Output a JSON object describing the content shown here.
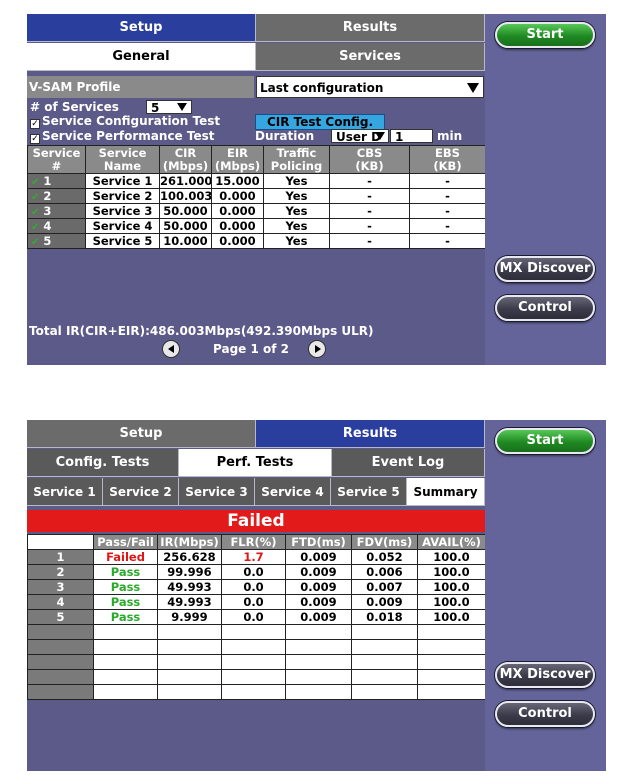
{
  "screen1": {
    "tabs": {
      "setup": "Setup",
      "results": "Results",
      "general": "General",
      "services": "Services"
    },
    "vsam_profile_label": "V-SAM Profile",
    "vsam_profile_value": "Last configuration",
    "num_services_label": "# of Services",
    "num_services_value": "5",
    "service_config_test": "Service Configuration Test",
    "service_perf_test": "Service Performance Test",
    "cir_test_config": "CIR Test Config.",
    "duration_label": "Duration",
    "duration_unit_value": "User D",
    "duration_value": "1",
    "duration_unit": "min",
    "table": {
      "headers": [
        [
          "Service",
          "#"
        ],
        [
          "Service",
          "Name"
        ],
        [
          "CIR",
          "(Mbps)"
        ],
        [
          "EIR",
          "(Mbps)"
        ],
        [
          "Traffic",
          "Policing"
        ],
        [
          "CBS",
          "(KB)"
        ],
        [
          "EBS",
          "(KB)"
        ]
      ],
      "rows": [
        {
          "num": "1",
          "name": "Service 1",
          "cir": "261.000",
          "eir": "15.000",
          "policing": "Yes",
          "cbs": "-",
          "ebs": "-"
        },
        {
          "num": "2",
          "name": "Service 2",
          "cir": "100.003",
          "eir": "0.000",
          "policing": "Yes",
          "cbs": "-",
          "ebs": "-"
        },
        {
          "num": "3",
          "name": "Service 3",
          "cir": "50.000",
          "eir": "0.000",
          "policing": "Yes",
          "cbs": "-",
          "ebs": "-"
        },
        {
          "num": "4",
          "name": "Service 4",
          "cir": "50.000",
          "eir": "0.000",
          "policing": "Yes",
          "cbs": "-",
          "ebs": "-"
        },
        {
          "num": "5",
          "name": "Service 5",
          "cir": "10.000",
          "eir": "0.000",
          "policing": "Yes",
          "cbs": "-",
          "ebs": "-"
        }
      ]
    },
    "total_ir": "Total IR(CIR+EIR):486.003Mbps(492.390Mbps ULR)",
    "page": "Page 1 of 2",
    "side": {
      "start": "Start",
      "mx_discover": "MX Discover",
      "control": "Control"
    }
  },
  "screen2": {
    "tabs": {
      "setup": "Setup",
      "results": "Results",
      "config_tests": "Config. Tests",
      "perf_tests": "Perf. Tests",
      "event_log": "Event Log",
      "service1": "Service 1",
      "service2": "Service 2",
      "service3": "Service 3",
      "service4": "Service 4",
      "service5": "Service 5",
      "summary": "Summary"
    },
    "status_banner": "Failed",
    "table": {
      "headers": [
        "",
        "Pass/Fail",
        "IR(Mbps)",
        "FLR(%)",
        "FTD(ms)",
        "FDV(ms)",
        "AVAIL(%)"
      ],
      "rows": [
        {
          "num": "1",
          "result": "Failed",
          "ir": "256.628",
          "flr": "1.7",
          "ftd": "0.009",
          "fdv": "0.052",
          "avail": "100.0"
        },
        {
          "num": "2",
          "result": "Pass",
          "ir": "99.996",
          "flr": "0.0",
          "ftd": "0.009",
          "fdv": "0.006",
          "avail": "100.0"
        },
        {
          "num": "3",
          "result": "Pass",
          "ir": "49.993",
          "flr": "0.0",
          "ftd": "0.009",
          "fdv": "0.007",
          "avail": "100.0"
        },
        {
          "num": "4",
          "result": "Pass",
          "ir": "49.993",
          "flr": "0.0",
          "ftd": "0.009",
          "fdv": "0.009",
          "avail": "100.0"
        },
        {
          "num": "5",
          "result": "Pass",
          "ir": "9.999",
          "flr": "0.0",
          "ftd": "0.009",
          "fdv": "0.018",
          "avail": "100.0"
        }
      ]
    },
    "side": {
      "start": "Start",
      "mx_discover": "MX Discover",
      "control": "Control"
    }
  },
  "colors": {
    "screen_bg": "#5b5a88",
    "tab_selected_blue": "#2a3e9e",
    "fail_red": "#e21a1a",
    "pass_green": "#2caa2c",
    "start_green": "#1f8a22",
    "cyan_button": "#36a6e0"
  }
}
